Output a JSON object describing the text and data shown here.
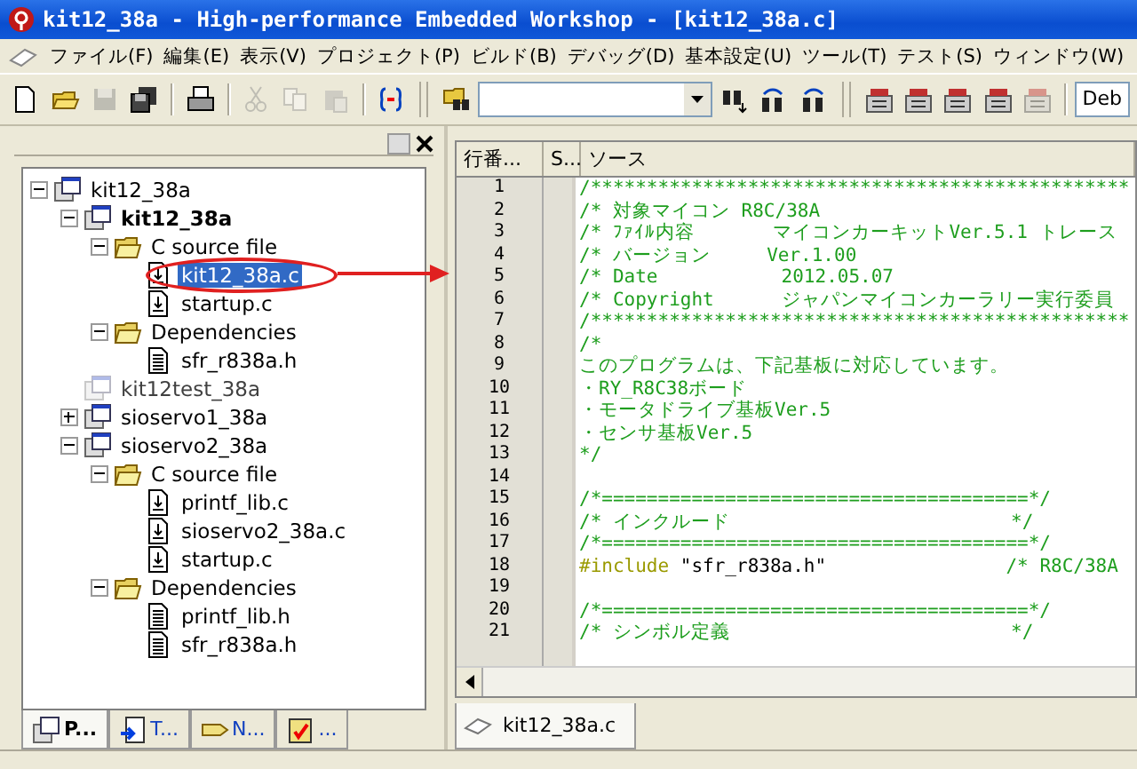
{
  "window": {
    "title": "kit12_38a - High-performance Embedded Workshop - [kit12_38a.c]"
  },
  "menu": [
    "ファイル(F)",
    "編集(E)",
    "表示(V)",
    "プロジェクト(P)",
    "ビルド(B)",
    "デバッグ(D)",
    "基本設定(U)",
    "ツール(T)",
    "テスト(S)",
    "ウィンドウ(W)"
  ],
  "toolbar": {
    "items": [
      {
        "kind": "new",
        "disabled": false
      },
      {
        "kind": "open",
        "disabled": false
      },
      {
        "kind": "save",
        "disabled": true
      },
      {
        "kind": "save-all",
        "disabled": false
      },
      {
        "kind": "sep"
      },
      {
        "kind": "print",
        "disabled": false
      },
      {
        "kind": "sep"
      },
      {
        "kind": "cut",
        "disabled": true
      },
      {
        "kind": "copy",
        "disabled": true
      },
      {
        "kind": "paste",
        "disabled": true
      },
      {
        "kind": "sep"
      },
      {
        "kind": "braces",
        "disabled": false
      },
      {
        "kind": "grip"
      },
      {
        "kind": "find-in-files",
        "disabled": false
      },
      {
        "kind": "combo"
      },
      {
        "kind": "find",
        "disabled": false
      },
      {
        "kind": "find-next",
        "disabled": false
      },
      {
        "kind": "find-prev",
        "disabled": false
      },
      {
        "kind": "grip"
      },
      {
        "kind": "build",
        "disabled": false
      },
      {
        "kind": "build",
        "disabled": false
      },
      {
        "kind": "build",
        "disabled": false
      },
      {
        "kind": "build",
        "disabled": false
      },
      {
        "kind": "build",
        "disabled": true
      },
      {
        "kind": "sep"
      },
      {
        "kind": "config",
        "value": "Deb"
      }
    ]
  },
  "workspace": {
    "tree": [
      {
        "label": "kit12_38a",
        "kind": "workspace",
        "expanded": true,
        "selected": false,
        "children": [
          {
            "label": "kit12_38a",
            "kind": "project",
            "active": true,
            "disabled": false,
            "expanded": true,
            "selected": false,
            "children": [
              {
                "label": "C source file",
                "kind": "folder",
                "expanded": true,
                "selected": false,
                "children": [
                  {
                    "label": "kit12_38a.c",
                    "kind": "source",
                    "selected": true
                  },
                  {
                    "label": "startup.c",
                    "kind": "source",
                    "selected": false
                  }
                ]
              },
              {
                "label": "Dependencies",
                "kind": "folder",
                "expanded": true,
                "selected": false,
                "children": [
                  {
                    "label": "sfr_r838a.h",
                    "kind": "header",
                    "selected": false
                  }
                ]
              }
            ]
          },
          {
            "label": "kit12test_38a",
            "kind": "project",
            "active": false,
            "disabled": true,
            "selected": false
          },
          {
            "label": "sioservo1_38a",
            "kind": "project",
            "active": false,
            "disabled": false,
            "expanded": false,
            "selected": false
          },
          {
            "label": "sioservo2_38a",
            "kind": "project",
            "active": false,
            "disabled": false,
            "expanded": true,
            "selected": false,
            "children": [
              {
                "label": "C source file",
                "kind": "folder",
                "expanded": true,
                "selected": false,
                "children": [
                  {
                    "label": "printf_lib.c",
                    "kind": "source",
                    "selected": false
                  },
                  {
                    "label": "sioservo2_38a.c",
                    "kind": "source",
                    "selected": false
                  },
                  {
                    "label": "startup.c",
                    "kind": "source",
                    "selected": false
                  }
                ]
              },
              {
                "label": "Dependencies",
                "kind": "folder",
                "expanded": true,
                "selected": false,
                "children": [
                  {
                    "label": "printf_lib.h",
                    "kind": "header",
                    "selected": false
                  },
                  {
                    "label": "sfr_r838a.h",
                    "kind": "header",
                    "selected": false
                  }
                ]
              }
            ]
          }
        ]
      }
    ],
    "tabs": [
      {
        "label": "P...",
        "kind": "projects",
        "selected": true
      },
      {
        "label": "T...",
        "kind": "templates",
        "selected": false
      },
      {
        "label": "N...",
        "kind": "navigation",
        "selected": false
      },
      {
        "label": "...",
        "kind": "tests",
        "selected": false
      }
    ]
  },
  "editor": {
    "columns": [
      "行番...",
      "S...",
      "ソース"
    ],
    "lines": [
      {
        "number": "1",
        "segments": [
          {
            "kind": "comment",
            "text": "/************************************************"
          }
        ]
      },
      {
        "number": "2",
        "segments": [
          {
            "kind": "comment",
            "text": "/* 対象マイコン R8C/38A"
          }
        ]
      },
      {
        "number": "3",
        "segments": [
          {
            "kind": "comment",
            "text": "/* ﾌｧｲﾙ内容       マイコンカーキットVer.5.1 トレース"
          }
        ]
      },
      {
        "number": "4",
        "segments": [
          {
            "kind": "comment",
            "text": "/* バージョン     Ver.1.00"
          }
        ]
      },
      {
        "number": "5",
        "segments": [
          {
            "kind": "comment",
            "text": "/* Date           2012.05.07"
          }
        ]
      },
      {
        "number": "6",
        "segments": [
          {
            "kind": "comment",
            "text": "/* Copyright      ジャパンマイコンカーラリー実行委員"
          }
        ]
      },
      {
        "number": "7",
        "segments": [
          {
            "kind": "comment",
            "text": "/************************************************"
          }
        ]
      },
      {
        "number": "8",
        "segments": [
          {
            "kind": "comment",
            "text": "/*"
          }
        ]
      },
      {
        "number": "9",
        "segments": [
          {
            "kind": "comment",
            "text": "このプログラムは、下記基板に対応しています。"
          }
        ]
      },
      {
        "number": "10",
        "segments": [
          {
            "kind": "comment",
            "text": "・RY_R8C38ボード"
          }
        ]
      },
      {
        "number": "11",
        "segments": [
          {
            "kind": "comment",
            "text": "・モータドライブ基板Ver.5"
          }
        ]
      },
      {
        "number": "12",
        "segments": [
          {
            "kind": "comment",
            "text": "・センサ基板Ver.5"
          }
        ]
      },
      {
        "number": "13",
        "segments": [
          {
            "kind": "comment",
            "text": "*/"
          }
        ]
      },
      {
        "number": "14"
      },
      {
        "number": "15",
        "segments": [
          {
            "kind": "comment",
            "text": "/*======================================*/"
          }
        ]
      },
      {
        "number": "16",
        "segments": [
          {
            "kind": "comment",
            "text": "/* インクルード                         */"
          }
        ]
      },
      {
        "number": "17",
        "segments": [
          {
            "kind": "comment",
            "text": "/*======================================*/"
          }
        ]
      },
      {
        "number": "18",
        "segments": [
          {
            "kind": "directive",
            "text": "#include"
          },
          {
            "kind": "plain",
            "text": " \"sfr_r838a.h\"                "
          },
          {
            "kind": "comment",
            "text": "/* R8C/38A"
          }
        ]
      },
      {
        "number": "19"
      },
      {
        "number": "20",
        "segments": [
          {
            "kind": "comment",
            "text": "/*======================================*/"
          }
        ]
      },
      {
        "number": "21",
        "segments": [
          {
            "kind": "comment",
            "text": "/* シンボル定義                         */"
          }
        ]
      }
    ],
    "tabs": [
      {
        "label": "kit12_38a.c",
        "selected": true
      }
    ]
  }
}
